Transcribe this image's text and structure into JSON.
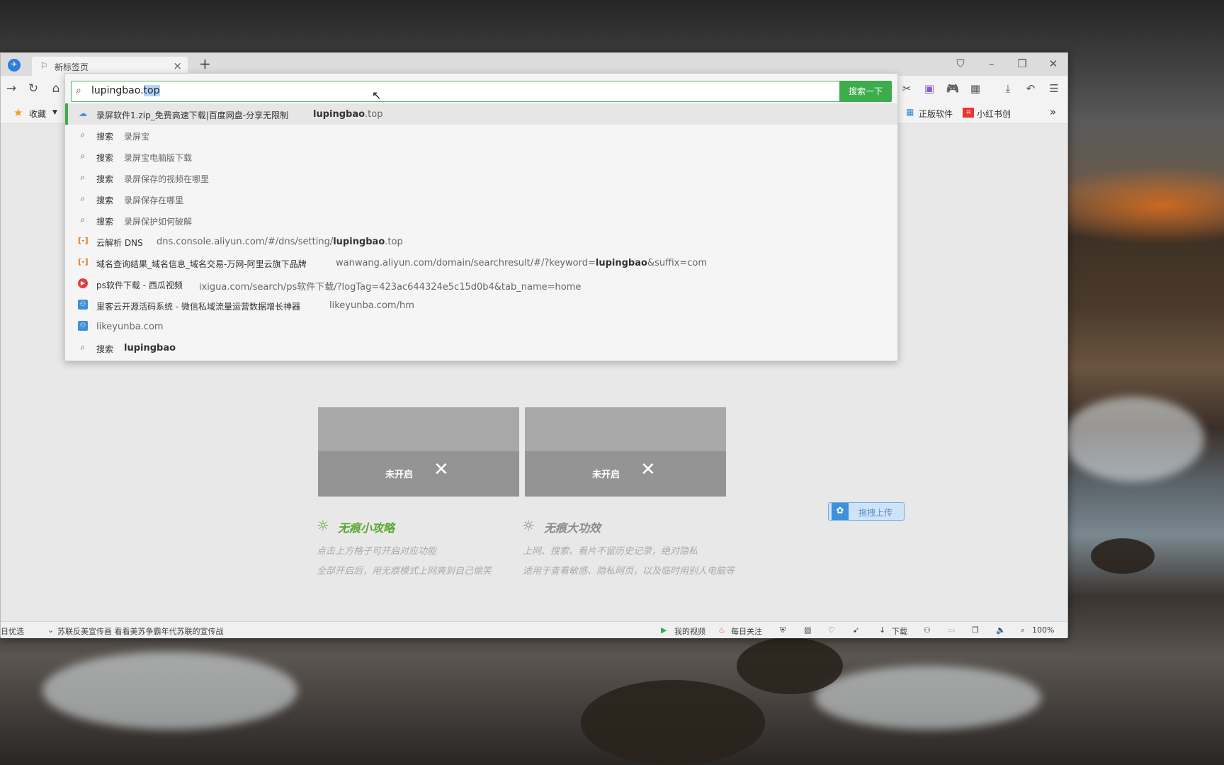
{
  "tab": {
    "title": "新标签页"
  },
  "omnibox": {
    "typed": "lupingbao.",
    "autocomplete": "top",
    "search_button": "搜索一下"
  },
  "bookmarks": {
    "favorites": "收藏",
    "right_items": [
      "正版软件",
      "小红书创"
    ],
    "more": "»"
  },
  "suggestions": [
    {
      "type": "page",
      "icon": "cloud-icon",
      "title": "录屏软件1.zip_免费高速下载|百度网盘-分享无限制",
      "url_bold": "lupingbao",
      "url_rest": ".top"
    },
    {
      "type": "search",
      "label": "搜索",
      "query": "录屏宝"
    },
    {
      "type": "search",
      "label": "搜索",
      "query": "录屏宝电脑版下载"
    },
    {
      "type": "search",
      "label": "搜索",
      "query": "录屏保存的视频在哪里"
    },
    {
      "type": "search",
      "label": "搜索",
      "query": "录屏保存在哪里"
    },
    {
      "type": "search",
      "label": "搜索",
      "query": "录屏保护如何破解"
    },
    {
      "type": "page",
      "icon": "aliyun-icon",
      "title": "云解析 DNS",
      "url_pre": "dns.console.aliyun.com/#/dns/setting/",
      "url_bold": "lupingbao",
      "url_rest": ".top"
    },
    {
      "type": "page",
      "icon": "aliyun-icon",
      "title": "域名查询结果_域名信息_域名交易-万网-阿里云旗下品牌",
      "url_pre": "wanwang.aliyun.com/domain/searchresult/#/?keyword=",
      "url_bold": "lupingbao",
      "url_rest": "&suffix=com"
    },
    {
      "type": "page",
      "icon": "xigua-icon",
      "title": "ps软件下载 - 西瓜视频",
      "url_pre": "ixigua.com/search/ps软件下载/?logTag=423ac644324e5c15d0b4&tab_name=home"
    },
    {
      "type": "page",
      "icon": "likeyunba-icon",
      "title": "里客云开源活码系统 - 微信私域流量运营数据增长神器",
      "url_pre": "likeyunba.com/hm"
    },
    {
      "type": "page",
      "icon": "likeyunba-icon",
      "title": "likeyunba.com"
    },
    {
      "type": "search",
      "label": "搜索",
      "query": "lupingbao",
      "bold": true
    }
  ],
  "cards": [
    {
      "status": "未开启"
    },
    {
      "status": "未开启"
    }
  ],
  "tips": {
    "left_title": "无痕小攻略",
    "left_lines": [
      "点击上方格子可开启对应功能",
      "全部开启后，用无痕模式上网爽到自己偷笑"
    ],
    "right_title": "无痕大功效",
    "right_lines": [
      "上网、搜索、看片不留历史记录，绝对隐私",
      "适用于查看敏感、隐私网页，以及临时用别人电脑等"
    ]
  },
  "upload_button": "拖拽上传",
  "statusbar": {
    "left": "日优选",
    "news": "苏联反美宣传画 看看美苏争霸年代苏联的宣传战",
    "my_video": "我的视频",
    "daily": "每日关注",
    "download": "下载",
    "zoom": "100%"
  },
  "colors": {
    "accent_green": "#3dac4a",
    "tips_green": "#5aa832",
    "tips_gray": "#8a8a8a"
  }
}
